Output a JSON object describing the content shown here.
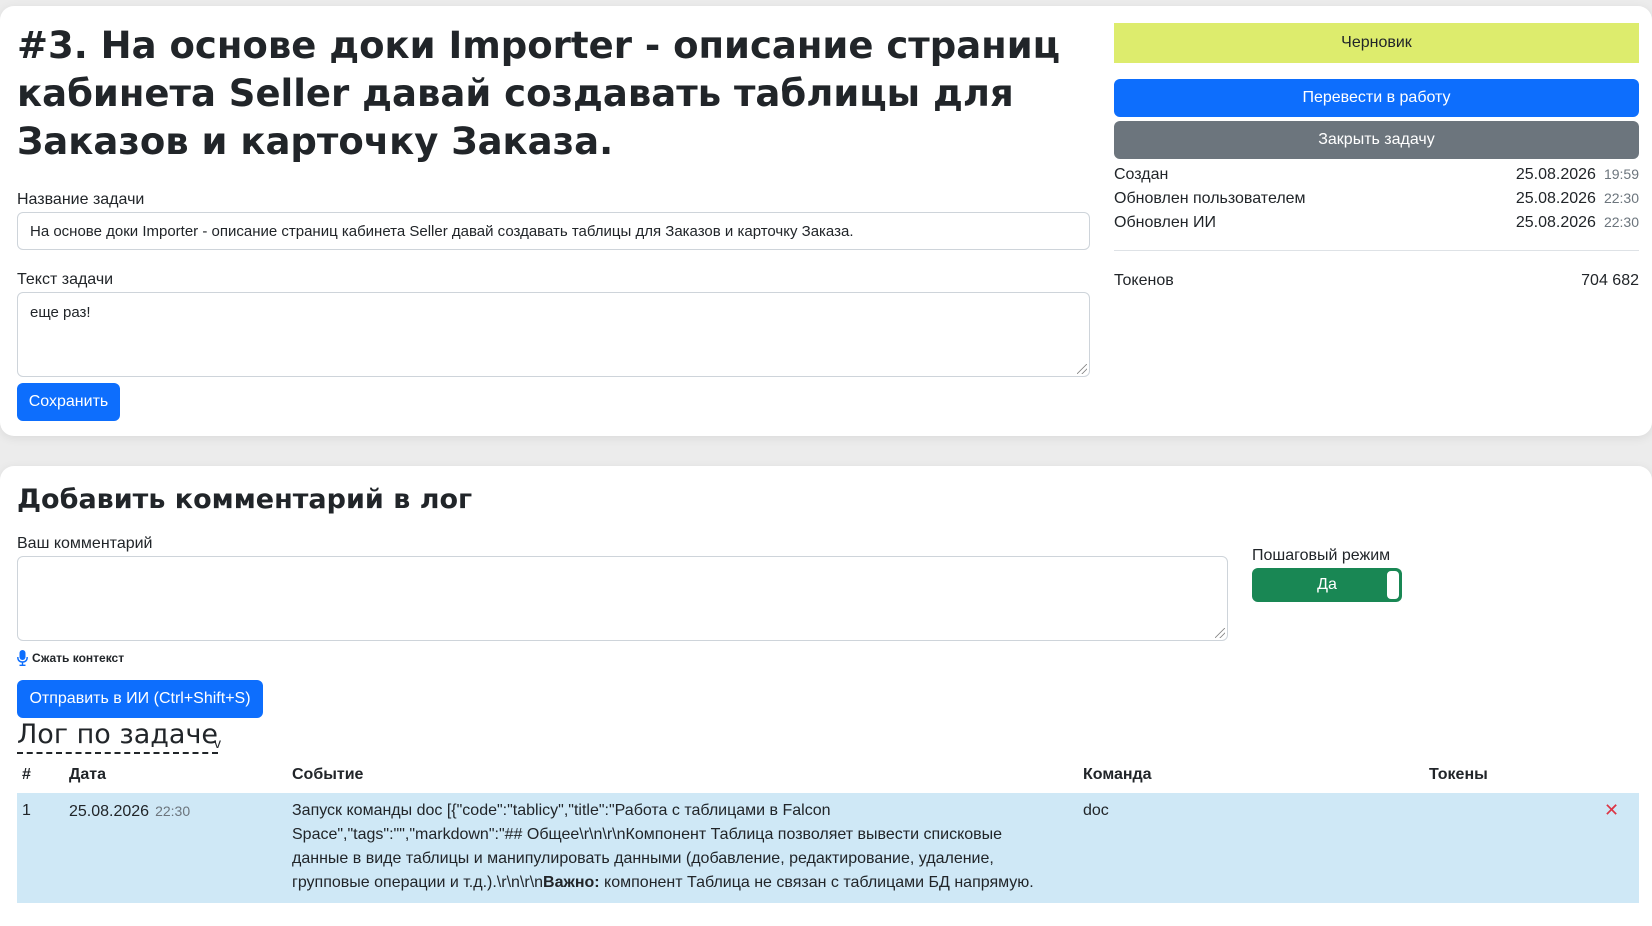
{
  "task": {
    "title": "#3. На основе доки Importer - описание страниц кабинета Seller давай создавать таблицы для Заказов и карточку Заказа.",
    "name_label": "Название задачи",
    "name_value": "На основе доки Importer - описание страниц кабинета Seller давай создавать таблицы для Заказов и карточку Заказа.",
    "text_label": "Текст задачи",
    "text_value": "еще раз!",
    "save_label": "Сохранить"
  },
  "sidebar": {
    "status": "Черновик",
    "status_color": "#ddec6d",
    "move_to_work_label": "Перевести в работу",
    "close_task_label": "Закрыть задачу",
    "meta": [
      {
        "label": "Создан",
        "date": "25.08.2026",
        "time": "19:59"
      },
      {
        "label": "Обновлен пользователем",
        "date": "25.08.2026",
        "time": "22:30"
      },
      {
        "label": "Обновлен ИИ",
        "date": "25.08.2026",
        "time": "22:30"
      }
    ],
    "tokens_label": "Токенов",
    "tokens_value": "704 682"
  },
  "comment": {
    "heading": "Добавить комментарий в лог",
    "comment_label": "Ваш комментарий",
    "comment_value": "",
    "step_mode_label": "Пошаговый режим",
    "step_mode_value": "Да",
    "compress_label": "Сжать контекст",
    "send_label": "Отправить в ИИ (Ctrl+Shift+S)"
  },
  "log": {
    "title": "Лог по задаче",
    "chevron": "v",
    "columns": [
      "#",
      "Дата",
      "Событие",
      "Команда",
      "Токены"
    ],
    "rows": [
      {
        "num": "1",
        "date": "25.08.2026",
        "time": "22:30",
        "event_line1": "Запуск команды doc [{\"code\":\"tablicy\",\"title\":\"Работа с таблицами в Falcon",
        "event_line2": "Space\",\"tags\":\"\",\"markdown\":\"## Общее\\r\\n\\r\\nКомпонент Таблица позволяет вывести списковые",
        "event_line3": "данные в виде таблицы и манипулировать данными (добавление, редактирование, удаление,",
        "event_line4_pre": "групповые операции и т.д.).\\r\\n\\r\\n",
        "event_line4_bold": "Важно:",
        "event_line4_post": " компонент Таблица не связан с таблицами БД напрямую.",
        "command": "doc",
        "tokens": "",
        "delete_glyph": "✕"
      }
    ]
  }
}
